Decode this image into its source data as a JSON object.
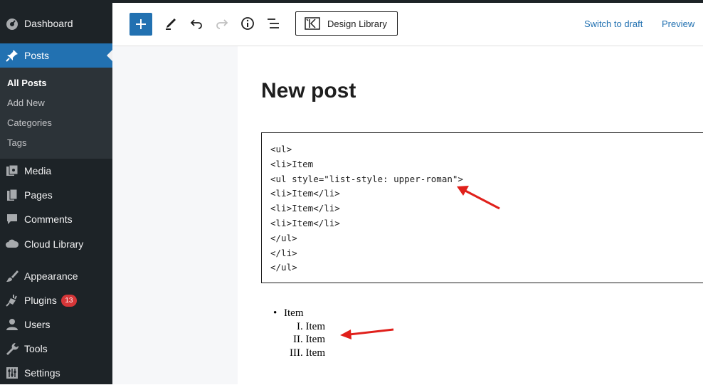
{
  "sidebar": {
    "dashboard": "Dashboard",
    "posts": "Posts",
    "submenu": [
      "All Posts",
      "Add New",
      "Categories",
      "Tags"
    ],
    "media": "Media",
    "pages": "Pages",
    "comments": "Comments",
    "cloud_library": "Cloud Library",
    "appearance": "Appearance",
    "plugins": "Plugins",
    "plugins_badge": "13",
    "users": "Users",
    "tools": "Tools",
    "settings": "Settings"
  },
  "toolbar": {
    "design_library": "Design Library",
    "switch_to_draft": "Switch to draft",
    "preview": "Preview"
  },
  "editor": {
    "title": "New post",
    "code_lines": [
      "<ul>",
      "<li>Item",
      "<ul style=\"list-style: upper-roman\">",
      "<li>Item</li>",
      "<li>Item</li>",
      "<li>Item</li>",
      "</ul>",
      "</li>",
      "</ul>"
    ]
  },
  "preview_list": {
    "bullet": "•",
    "top_item": "Item",
    "sub_items": [
      {
        "marker": "I.",
        "text": "Item"
      },
      {
        "marker": "II.",
        "text": "Item"
      },
      {
        "marker": "III.",
        "text": "Item"
      }
    ]
  },
  "colors": {
    "sidebar_bg": "#1d2327",
    "accent": "#2271b1",
    "badge": "#d63638",
    "annotation_arrow": "#e0201b"
  }
}
